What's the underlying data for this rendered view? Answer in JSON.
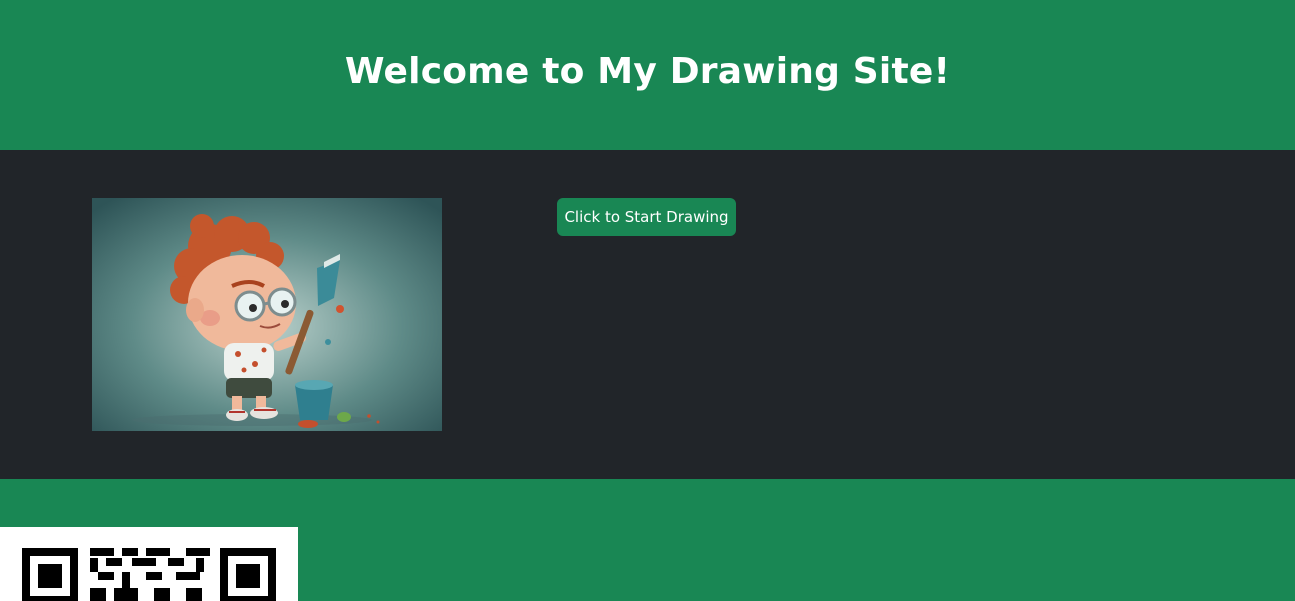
{
  "header": {
    "title": "Welcome to My Drawing Site!"
  },
  "main": {
    "image": {
      "icon": "child-painter-illustration"
    },
    "start_button_label": "Click to Start Drawing"
  },
  "footer": {
    "qr": {
      "icon": "qr-code"
    }
  },
  "colors": {
    "brand_green": "#198754",
    "dark_background": "#212529",
    "white": "#ffffff"
  }
}
